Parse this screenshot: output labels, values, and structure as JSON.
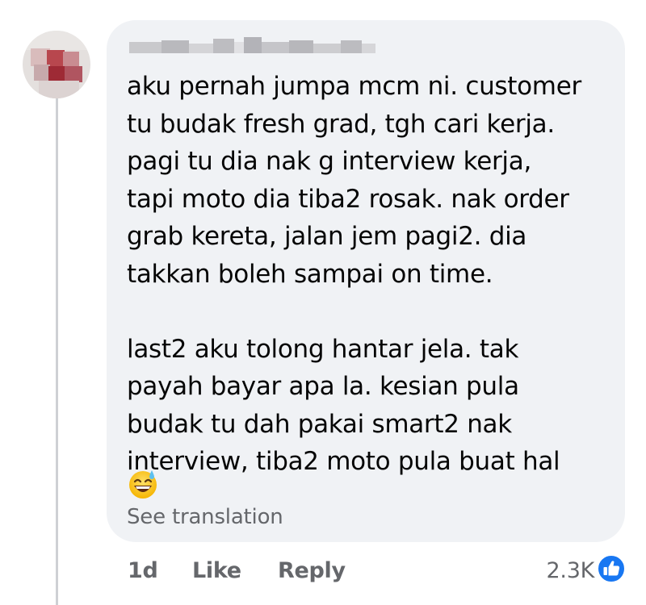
{
  "comment": {
    "author": "",
    "paragraphs": [
      [
        "aku pernah jumpa mcm ni. customer",
        "tu budak fresh grad, tgh cari kerja.",
        "pagi tu dia nak g interview kerja,",
        "tapi moto dia tiba2 rosak. nak order",
        "grab kereta, jalan jem pagi2. dia",
        "takkan boleh sampai on time."
      ],
      [
        "last2 aku tolong hantar jela. tak",
        "payah bayar apa la. kesian pula",
        "budak tu dah pakai smart2 nak",
        "interview, tiba2 moto pula buat hal"
      ]
    ],
    "emoji": "grinning-face-with-sweat",
    "see_translation": "See translation"
  },
  "actions": {
    "timestamp": "1d",
    "like_label": "Like",
    "reply_label": "Reply"
  },
  "reactions": {
    "count": "2.3K",
    "icon": "like-thumb-icon"
  },
  "colors": {
    "bubble": "#f0f2f5",
    "text": "#050505",
    "secondary": "#65676b",
    "like_blue": "#1877f2"
  }
}
